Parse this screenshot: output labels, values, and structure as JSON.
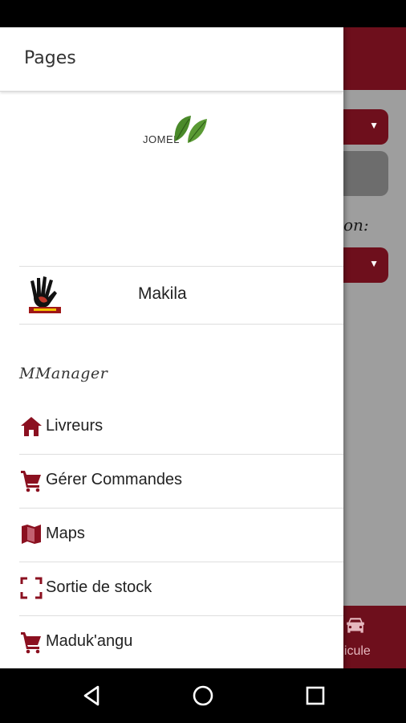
{
  "drawer": {
    "title": "Pages",
    "brand": {
      "text": "JOMEL"
    },
    "account": {
      "name": "Makila"
    },
    "section_title": "MManager",
    "menu": [
      {
        "label": "Livreurs",
        "icon": "home-icon"
      },
      {
        "label": "Gérer Commandes",
        "icon": "cart-icon"
      },
      {
        "label": "Maps",
        "icon": "map-icon"
      },
      {
        "label": "Sortie de stock",
        "icon": "scan-frame-icon"
      },
      {
        "label": "Maduk'angu",
        "icon": "cart-icon"
      }
    ]
  },
  "background": {
    "field_label_fragment": "on:",
    "bottom_tab_label": "hicule"
  },
  "colors": {
    "accent": "#6e0f1c",
    "icon": "#8b1020"
  }
}
